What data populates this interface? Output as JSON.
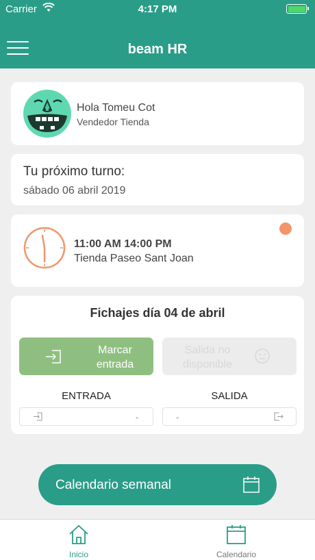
{
  "status_bar": {
    "carrier": "Carrier",
    "time": "4:17 PM"
  },
  "header": {
    "title": "beam HR"
  },
  "user": {
    "greeting": "Hola Tomeu Cot",
    "role": "Vendedor Tienda"
  },
  "next_shift": {
    "title": "Tu próximo turno:",
    "date": "sábado 06 abril 2019"
  },
  "shift_slot": {
    "hours": "11:00 AM 14:00 PM",
    "place": "Tienda Paseo Sant Joan"
  },
  "fichajes": {
    "title": "Fichajes día 04 de abril",
    "check_in_line1": "Marcar",
    "check_in_line2": "entrada",
    "check_out_line1": "Salida no",
    "check_out_line2": "disponible",
    "entrada_label": "ENTRADA",
    "salida_label": "SALIDA",
    "entrada_value": "-",
    "salida_value": "-"
  },
  "calendar_button": {
    "label": "Calendario semanal"
  },
  "tabs": [
    {
      "label": "Inicio"
    },
    {
      "label": "Calendario"
    }
  ],
  "colors": {
    "primary": "#2a9d88",
    "check_in": "#8fbf80",
    "avatar": "#5fd8b2",
    "accent": "#f2956b"
  }
}
